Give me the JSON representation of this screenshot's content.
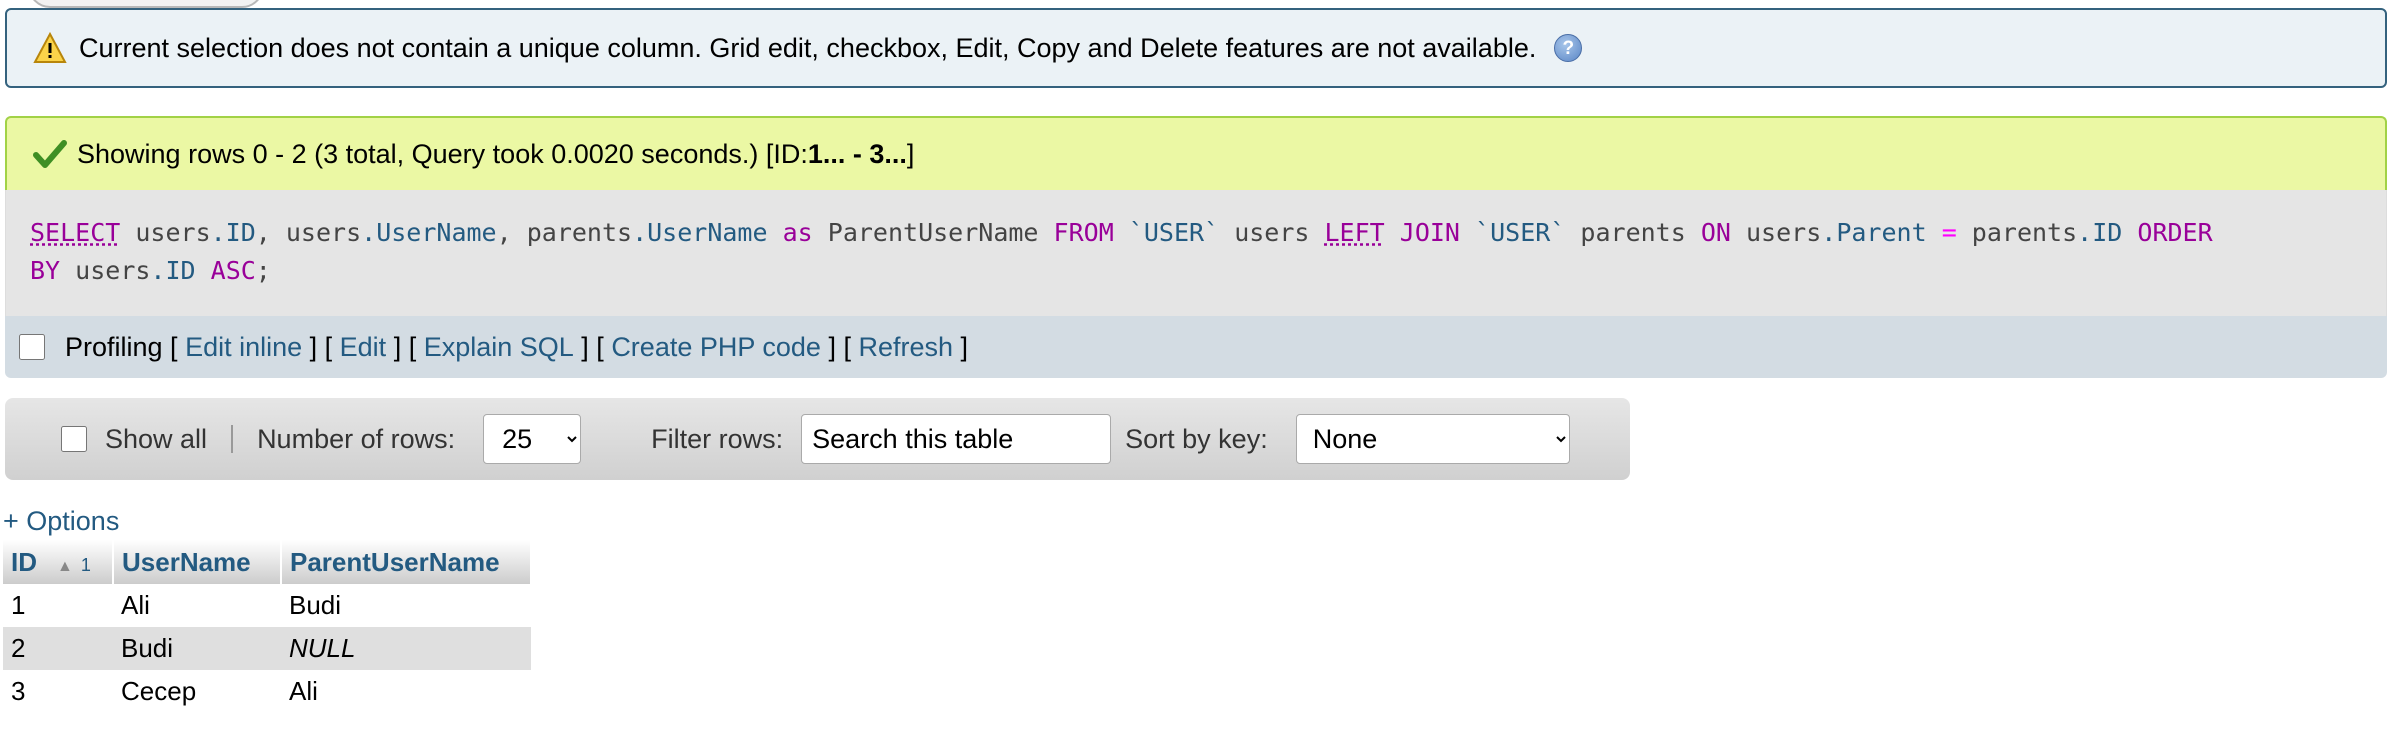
{
  "notice": {
    "text": "Current selection does not contain a unique column. Grid edit, checkbox, Edit, Copy and Delete features are not available.",
    "help_icon": "?"
  },
  "success": {
    "text": "Showing rows 0 - 2 (3 total, Query took 0.0020 seconds.) [ID: ",
    "range": "1... - 3...",
    "close": "]"
  },
  "sql": {
    "line1": "SELECT users.ID, users.UserName, parents.UserName as ParentUserName FROM `USER` users LEFT JOIN `USER` parents ON users.Parent = parents.ID ORDER",
    "line2": "BY users.ID ASC;"
  },
  "tools": {
    "profiling": "Profiling",
    "edit_inline": "Edit inline",
    "edit": "Edit",
    "explain": "Explain SQL",
    "create_php": "Create PHP code",
    "refresh": "Refresh"
  },
  "nav": {
    "show_all": "Show all",
    "number_of_rows_label": "Number of rows:",
    "rows_value": "25",
    "filter_label": "Filter rows:",
    "search_placeholder": "Search this table",
    "sort_label": "Sort by key:",
    "sort_value": "None"
  },
  "options_link": "+ Options",
  "table": {
    "headers": [
      "ID",
      "UserName",
      "ParentUserName"
    ],
    "sort_index": "1",
    "rows": [
      [
        "1",
        "Ali",
        "Budi"
      ],
      [
        "2",
        "Budi",
        "NULL"
      ],
      [
        "3",
        "Cecep",
        "Ali"
      ]
    ]
  }
}
